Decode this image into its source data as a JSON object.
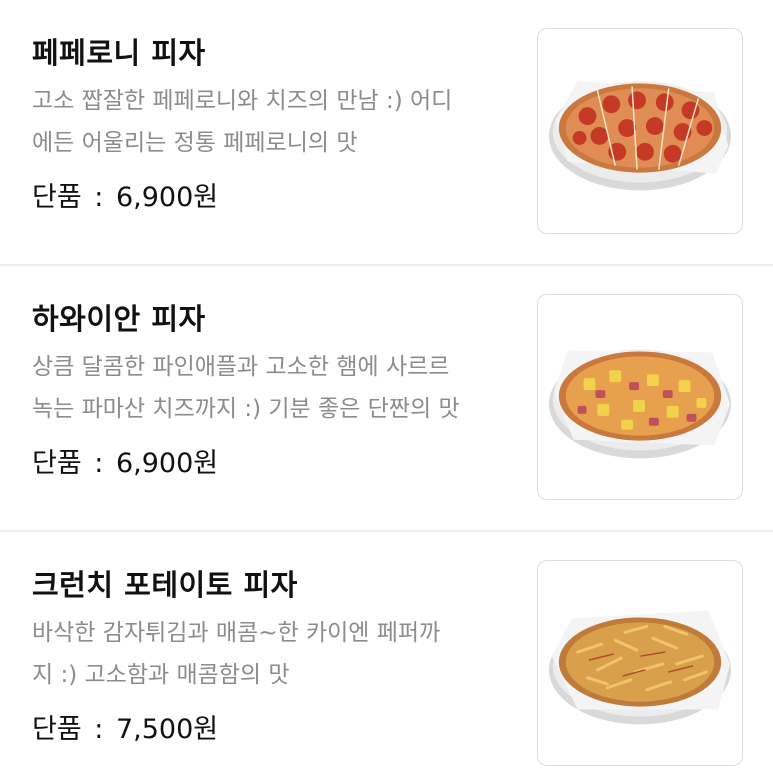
{
  "menu": {
    "items": [
      {
        "name": "페페로니 피자",
        "desc_line1": "고소 짭잘한 페페로니와 치즈의 만남 :) 어디",
        "desc_line2": "에든 어울리는 정통 페페로니의 맛",
        "price_label": "단품",
        "price_sep": ":",
        "price": "6,900원",
        "image": "pepperoni-pizza-image"
      },
      {
        "name": "하와이안 피자",
        "desc_line1": "상큼 달콤한 파인애플과 고소한 햄에 사르르",
        "desc_line2": "녹는 파마산 치즈까지 :) 기분 좋은 단짠의 맛",
        "price_label": "단품",
        "price_sep": ":",
        "price": "6,900원",
        "image": "hawaiian-pizza-image"
      },
      {
        "name": "크런치 포테이토 피자",
        "desc_line1": "바삭한 감자튀김과 매콤~한 카이엔 페퍼까",
        "desc_line2": "지 :) 고소함과 매콤함의 맛",
        "price_label": "단품",
        "price_sep": ":",
        "price": "7,500원",
        "image": "crunch-potato-pizza-image"
      }
    ]
  },
  "colors": {
    "title": "#111111",
    "description": "#8c8c8c",
    "divider": "#eeeeee",
    "thumb_border": "#dcdcdc"
  }
}
